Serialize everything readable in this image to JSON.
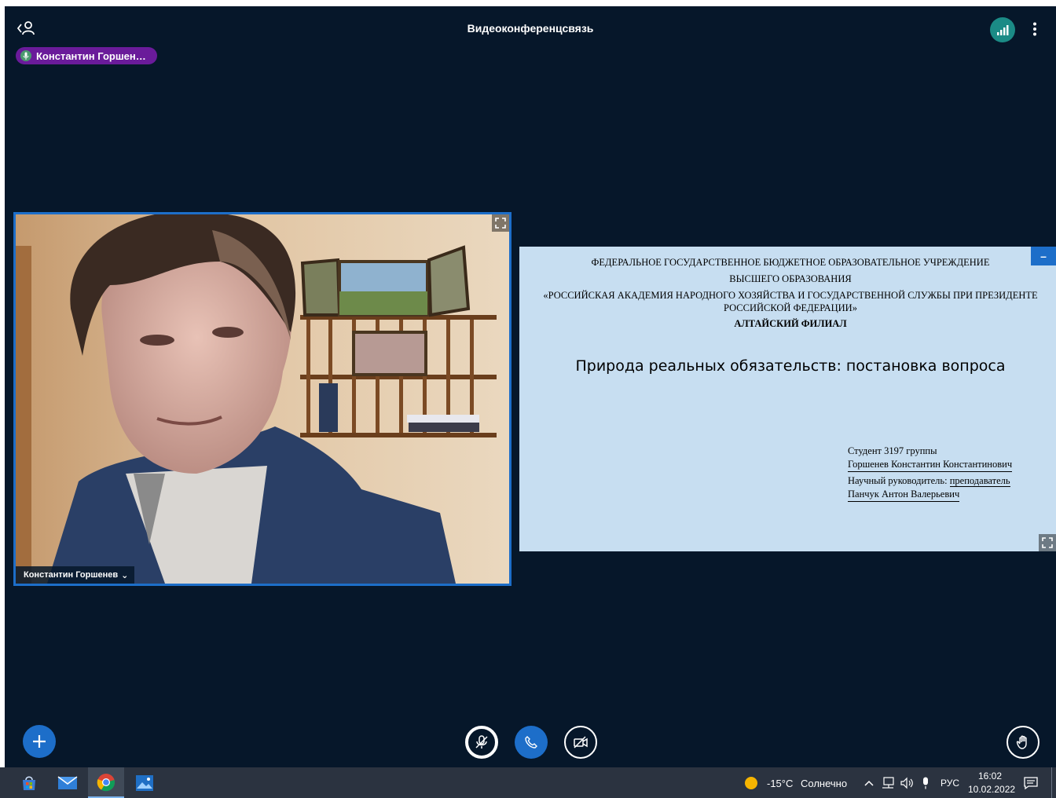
{
  "app": {
    "title": "Видеоконференцсвязь",
    "talker_name": "Константин Горшен…",
    "colors": {
      "background": "#06172a",
      "accent": "#1d6ec9",
      "talker_chip": "#6a1b9a",
      "connection": "#1b8b86"
    }
  },
  "video": {
    "user_name": "Константин Горшенев",
    "dropdown_glyph": "⌄"
  },
  "presentation": {
    "header_line1": "ФЕДЕРАЛЬНОЕ ГОСУДАРСТВЕННОЕ БЮДЖЕТНОЕ ОБРАЗОВАТЕЛЬНОЕ УЧРЕЖДЕНИЕ",
    "header_line2": "ВЫСШЕГО ОБРАЗОВАНИЯ",
    "header_line3": "«РОССИЙСКАЯ АКАДЕМИЯ НАРОДНОГО ХОЗЯЙСТВА И ГОСУДАРСТВЕННОЙ СЛУЖБЫ ПРИ ПРЕЗИДЕНТЕ РОССИЙСКОЙ ФЕДЕРАЦИИ»",
    "header_line4": "АЛТАЙСКИЙ ФИЛИАЛ",
    "topic": "Природа реальных обязательств: постановка вопроса",
    "student_group": "Студент 3197 группы",
    "student_name": "Горшенев Константин Константинович",
    "advisor_label": "Научный руководитель: ",
    "advisor_title": "преподаватель",
    "advisor_name": "Панчук Антон Валерьевич",
    "minimize_glyph": "–"
  },
  "controls": {
    "actions_icon": "plus-icon",
    "mic_icon": "microphone-muted-icon",
    "phone_icon": "phone-icon",
    "camera_icon": "camera-off-icon",
    "hand_icon": "raise-hand-icon"
  },
  "taskbar": {
    "apps": [
      "microsoft-store-icon",
      "mail-icon",
      "chrome-icon",
      "photos-icon"
    ],
    "weather_temp": "-15°C",
    "weather_text": "Солнечно",
    "language": "РУС",
    "time": "16:02",
    "date": "10.02.2022"
  }
}
